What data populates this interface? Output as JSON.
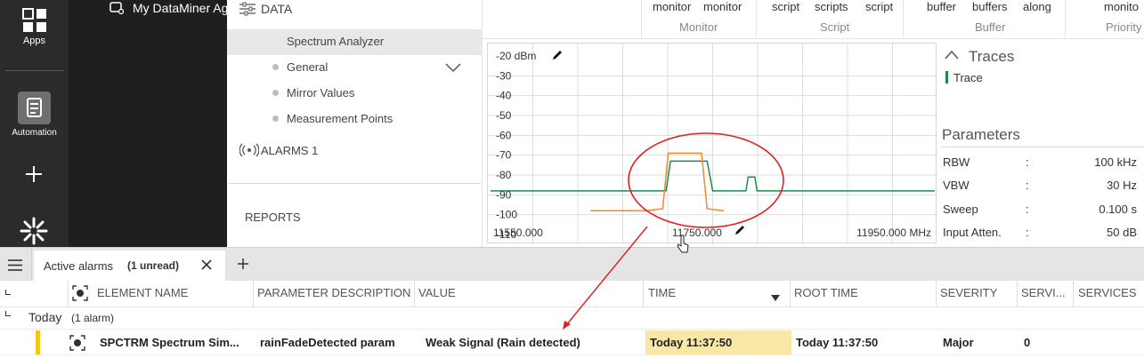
{
  "rail": {
    "apps_label": "Apps",
    "automation_label": "Automation"
  },
  "window": {
    "title": "My DataMiner Ag"
  },
  "left_nav": {
    "data_label": "DATA",
    "items": [
      {
        "label": "Spectrum Analyzer"
      },
      {
        "label": "General"
      },
      {
        "label": "Mirror Values"
      },
      {
        "label": "Measurement Points"
      }
    ],
    "alarms_label": "ALARMS 1",
    "reports_label": "REPORTS"
  },
  "header_groups": [
    {
      "items": [
        "monitor",
        "monitor"
      ],
      "group": "Monitor"
    },
    {
      "items": [
        "script",
        "scripts",
        "script"
      ],
      "group": "Script"
    },
    {
      "items": [
        "buffer",
        "buffers",
        "along"
      ],
      "group": "Buffer"
    },
    {
      "items": [
        "monito"
      ],
      "group": "Priority"
    }
  ],
  "chart_data": {
    "type": "line",
    "title": "",
    "ylabel_top": "-20 dBm",
    "y_ticks": [
      "-30",
      "-40",
      "-50",
      "-60",
      "-70",
      "-80",
      "-90",
      "-100",
      "-110"
    ],
    "ylim": [
      -110,
      -20
    ],
    "x_ticks": [
      "11550.000",
      "11750.000",
      "11950.000 MHz"
    ],
    "xlim": [
      11550,
      11950
    ],
    "series": [
      {
        "color": "#1e8a4a",
        "x": [
          11550,
          11620,
          11690,
          11700,
          11708,
          11712,
          11745,
          11750,
          11770,
          11780,
          11782,
          11788,
          11790,
          11800,
          11950
        ],
        "y": [
          -88,
          -88,
          -88,
          -88,
          -88,
          -73,
          -73,
          -88,
          -88,
          -88,
          -81,
          -81,
          -88,
          -88,
          -88
        ]
      },
      {
        "color": "#f08a2a",
        "x": [
          11640,
          11690,
          11705,
          11710,
          11740,
          11745,
          11760
        ],
        "y": [
          -98,
          -98,
          -97,
          -69,
          -69,
          -97,
          -98
        ]
      }
    ]
  },
  "traces": {
    "title": "Traces",
    "items": [
      {
        "label": "Trace",
        "color": "#1e8a4a"
      }
    ]
  },
  "parameters": {
    "title": "Parameters",
    "rows": [
      {
        "name": "RBW",
        "sep": ":",
        "value": "100 kHz"
      },
      {
        "name": "VBW",
        "sep": ":",
        "value": "30 Hz"
      },
      {
        "name": "Sweep",
        "sep": ":",
        "value": "0.100 s"
      },
      {
        "name": "Input Atten.",
        "sep": ":",
        "value": "50 dB"
      }
    ]
  },
  "alarms_tab": {
    "label": "Active alarms",
    "unread": "(1 unread)"
  },
  "alarm_table": {
    "columns": [
      "ELEMENT NAME",
      "PARAMETER DESCRIPTION",
      "VALUE",
      "TIME",
      "ROOT TIME",
      "SEVERITY",
      "SERVI...",
      "SERVICES"
    ],
    "group": {
      "label": "Today",
      "count": "(1 alarm)"
    },
    "rows": [
      {
        "element": "SPCTRM Spectrum Sim...",
        "parameter": "rainFadeDetected param",
        "value": "Weak Signal (Rain detected)",
        "time": "Today 11:37:50",
        "root_time": "Today 11:37:50",
        "severity": "Major",
        "servi": "0"
      }
    ]
  },
  "colors": {
    "major": "#f5c51a",
    "highlight_time": "#f9e7a8",
    "annotation": "#e02020"
  }
}
